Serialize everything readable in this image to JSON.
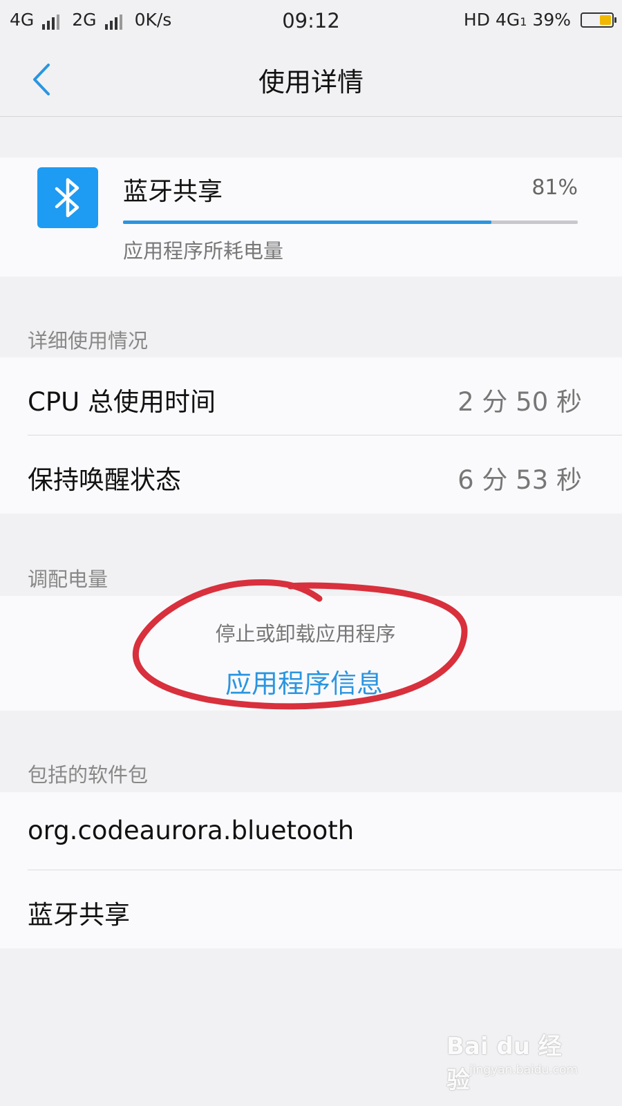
{
  "status_bar": {
    "net1": "4G",
    "net2": "2G",
    "speed": "0K/s",
    "time": "09:12",
    "hd": "HD",
    "net3": "4G",
    "net3_sub": "1",
    "battery": "39%",
    "battery_level": 0.39,
    "battery_color": "#f0b800"
  },
  "nav": {
    "back_icon": "chevron-left-icon",
    "title": "使用详情"
  },
  "app": {
    "icon": "bluetooth-icon",
    "icon_color": "#1e9bf2",
    "name": "蓝牙共享",
    "percent": "81%",
    "usage_fraction": 0.81,
    "subtitle": "应用程序所耗电量"
  },
  "details": {
    "header": "详细使用情况",
    "rows": [
      {
        "label": "CPU 总使用时间",
        "value": "2 分 50 秒"
      },
      {
        "label": "保持唤醒状态",
        "value": "6 分 53 秒"
      }
    ]
  },
  "power": {
    "header": "调配电量",
    "hint": "停止或卸载应用程序",
    "link": "应用程序信息",
    "accent": "#2a95e0",
    "annotation_color": "#d8303c"
  },
  "packages": {
    "header": "包括的软件包",
    "items": [
      {
        "label": "org.codeaurora.bluetooth"
      },
      {
        "label": "蓝牙共享"
      }
    ]
  },
  "watermark": {
    "main": "Bai du 经验",
    "sub": "jingyan.baidu.com"
  }
}
